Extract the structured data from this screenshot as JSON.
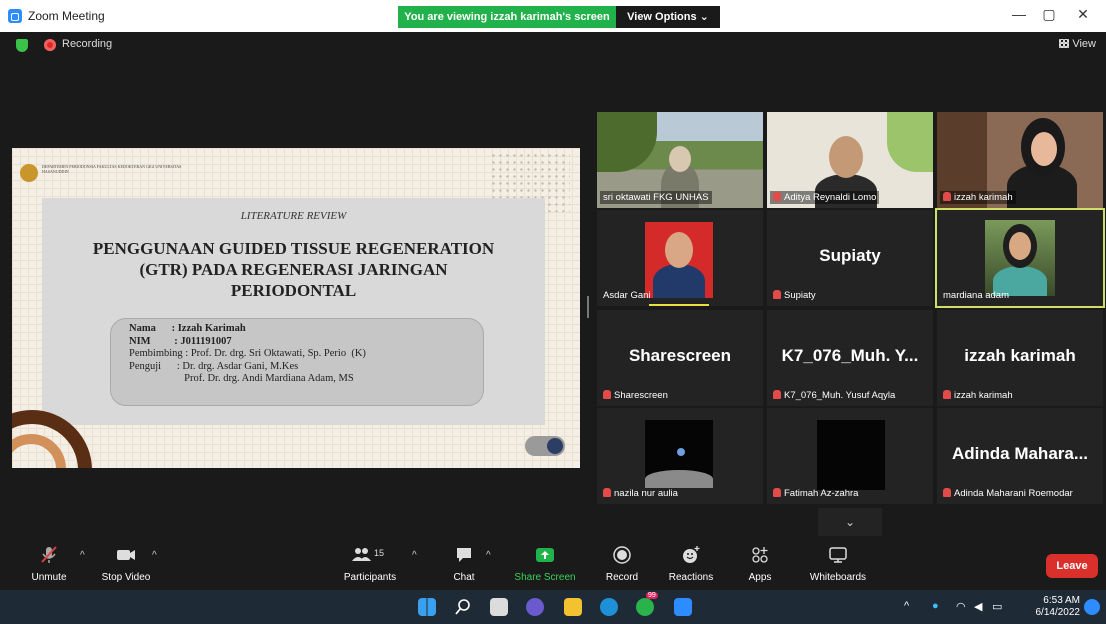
{
  "window": {
    "title": "Zoom Meeting",
    "banner": "You are viewing izzah karimah's screen",
    "view_options": "View Options ⌄",
    "min": "—",
    "max": "▢",
    "close": "✕"
  },
  "topbar": {
    "recording": "Recording",
    "view": "View"
  },
  "slide": {
    "institution": "DEPARTEMEN PERIODONSIA FAKULTAS KEDOKTERAN GIGI UNIVERSITAS HASANUDDIN",
    "subtitle": "LITERATURE REVIEW",
    "title_line1": "PENGGUNAAN GUIDED TISSUE REGENERATION",
    "title_line2": "(GTR) PADA REGENERASI JARINGAN",
    "title_line3": "PERIODONTAL",
    "info": [
      "Nama      : Izzah Karimah",
      "NIM         : J011191007",
      "Pembimbing : Prof. Dr. drg. Sri Oktawati, Sp. Perio  (K)",
      "Penguji      : Dr. drg. Asdar Gani, M.Kes",
      "                     Prof. Dr. drg. Andi Mardiana Adam, MS"
    ]
  },
  "tiles": [
    {
      "name": "sri oktawati FKG UNHAS"
    },
    {
      "name": "Aditya Reynaldi Lomo"
    },
    {
      "name": "izzah karimah"
    },
    {
      "name": "Asdar Gani"
    },
    {
      "name": "Supiaty",
      "big": "Supiaty"
    },
    {
      "name": "mardiana adam"
    },
    {
      "name": "Sharescreen",
      "big": "Sharescreen"
    },
    {
      "name": "K7_076_Muh. Yusuf Aqyla",
      "big": "K7_076_Muh. Y..."
    },
    {
      "name": "izzah karimah",
      "big": "izzah karimah"
    },
    {
      "name": "nazila nur aulia"
    },
    {
      "name": "Fatimah Az-zahra"
    },
    {
      "name": "Adinda Maharani Roemodar",
      "big": "Adinda  Mahara..."
    }
  ],
  "more_chevron": "⌄",
  "toolbar": {
    "unmute": "Unmute",
    "stop_video": "Stop Video",
    "participants": "Participants",
    "participants_count": "15",
    "chat": "Chat",
    "share_screen": "Share Screen",
    "record": "Record",
    "reactions": "Reactions",
    "apps": "Apps",
    "whiteboards": "Whiteboards",
    "leave": "Leave",
    "caret": "^"
  },
  "taskbar": {
    "time": "6:53 AM",
    "date": "6/14/2022",
    "whatsapp_badge": "99",
    "tray_chevron": "^"
  },
  "colors": {
    "accent": "#2d8cff",
    "banner": "#22b24c",
    "leave": "#d9302b",
    "active_border": "#cfdf6a"
  }
}
